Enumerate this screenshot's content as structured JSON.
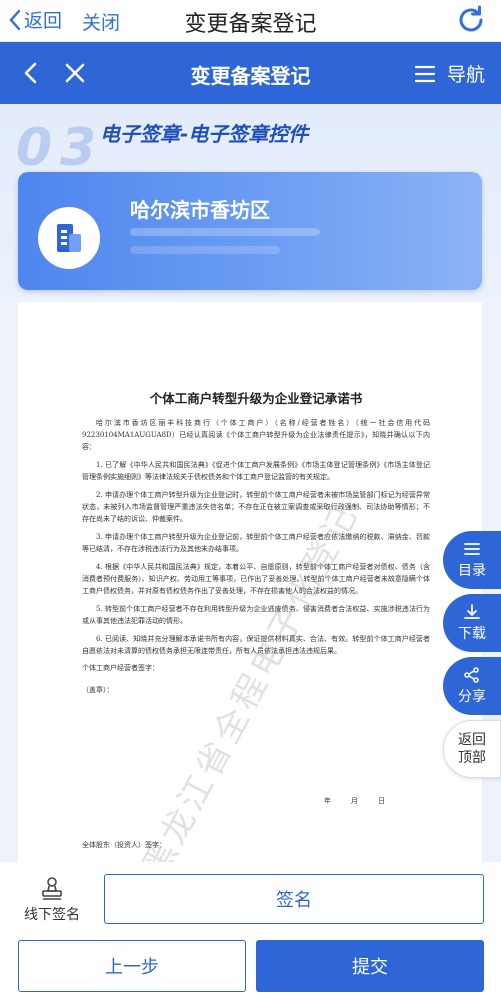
{
  "native_bar": {
    "back_label": "返回",
    "close_label": "关闭",
    "title": "变更备案登记"
  },
  "header": {
    "title": "变更备案登记",
    "nav_label": "导航"
  },
  "step": {
    "number": "03",
    "title": "电子签章-电子签章控件"
  },
  "region": {
    "name": "哈尔滨市香坊区"
  },
  "document": {
    "title": "个体工商户转型升级为企业登记承诺书",
    "paragraphs": [
      "哈尔滨市香坊区丽丰科技商行（个体工商户）（名称/经营者姓名）（统一社会信用代码 92230104MA1AUGUA8D）已经认真阅读《个体工商户转型升级为企业法律责任提示》，知晓并确认以下内容：",
      "1. 已了解《中华人民共和国民法典》《促进个体工商户发展条例》《市场主体登记管理条例》《市场主体登记管理条例实施细则》等法律法规关于债权债务和个体工商户登记监管的有关规定。",
      "2. 申请办理个体工商户转型升级为企业登记时，转型前个体工商户经营者未被市场监管部门标记为经营异常状态，未被列入市场监督管理严重违法失信名单；不存在正在被立案调查或采取行政强制、司法协助等情形；不存在尚未了结的诉讼、仲裁案件。",
      "3. 申请办理个体工商户转型升级为企业登记前，转型前个体工商户经营者应依法缴纳的税款、滞纳金、罚款等已结清，不存在涉税违法行为及其他未办结事项。",
      "4. 根据《中华人民共和国民法典》规定，本着公平、自愿原则，转型前个体工商户经营者对债权、债务（含消费者预付费服务）、知识产权、劳动用工等事项，已作出了妥善处理。转型前个体工商户经营者未故意隐瞒个体工商户债权债务，并对原有债权债务作出了妥善处理，不存在损害他人的合法权益的情况。",
      "5. 转型前个体工商户经营者不存在利用转型升级为企业逃废债务、侵害消费者合法权益、实施涉税违法行为或从事其他违法犯罪活动的情形。",
      "6. 已阅读、知晓并充分理解本承诺书所有内容，保证提供材料真实、合法、有效。转型前个体工商户经营者自愿依法对未清算的债权债务承担无限连带责任，所有人员依法承担违法违规后果。"
    ],
    "signature_label": "个体工商户经营者签字：",
    "seal_label": "（盖章）：",
    "date_label": "年　　月　　日",
    "holder_label": "全体股东（投资人）签字：",
    "watermark": "黑龙江省全程电子化登记"
  },
  "side_buttons": {
    "toc": "目录",
    "download": "下载",
    "share": "分享",
    "top": "返回顶部"
  },
  "offline_sign_label": "线下签名",
  "sign_label": "签名",
  "prev_label": "上一步",
  "submit_label": "提交",
  "colors": {
    "primary": "#2e66d8",
    "accent_text": "#1f4fb8"
  }
}
